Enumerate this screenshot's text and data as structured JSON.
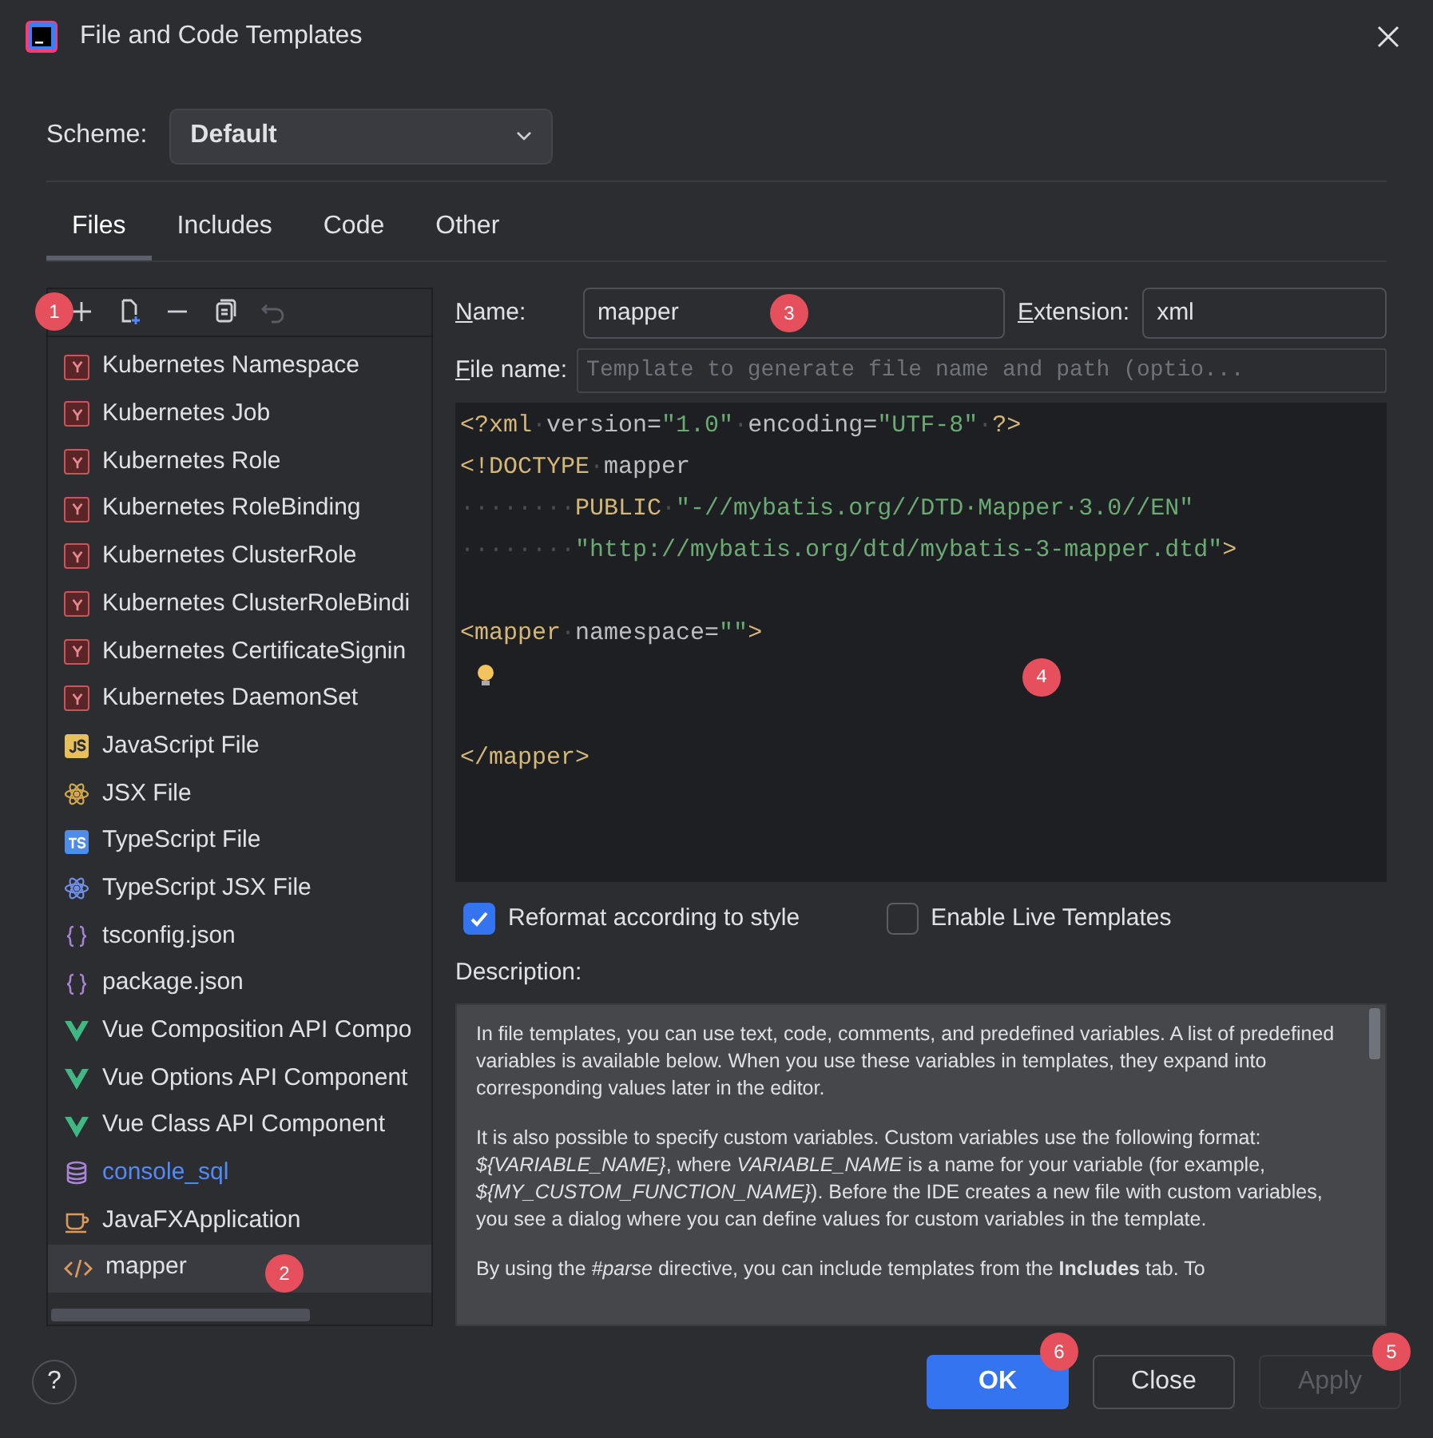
{
  "window": {
    "title": "File and Code Templates"
  },
  "scheme": {
    "label": "Scheme:",
    "value": "Default"
  },
  "tabs": [
    {
      "label": "Files",
      "selected": true
    },
    {
      "label": "Includes",
      "selected": false
    },
    {
      "label": "Code",
      "selected": false
    },
    {
      "label": "Other",
      "selected": false
    }
  ],
  "toolbar": {
    "badge": "1",
    "tools": [
      {
        "kind": "add",
        "disabled": false
      },
      {
        "kind": "new-file",
        "disabled": false
      },
      {
        "kind": "remove",
        "disabled": false
      },
      {
        "kind": "copy",
        "disabled": false
      },
      {
        "kind": "reset",
        "disabled": true
      }
    ]
  },
  "templates": [
    {
      "kind": "kubernetes",
      "label": "Kubernetes Namespace",
      "modified": false,
      "selected": false
    },
    {
      "kind": "kubernetes",
      "label": "Kubernetes Job",
      "modified": false,
      "selected": false
    },
    {
      "kind": "kubernetes",
      "label": "Kubernetes Role",
      "modified": false,
      "selected": false
    },
    {
      "kind": "kubernetes",
      "label": "Kubernetes RoleBinding",
      "modified": false,
      "selected": false
    },
    {
      "kind": "kubernetes",
      "label": "Kubernetes ClusterRole",
      "modified": false,
      "selected": false
    },
    {
      "kind": "kubernetes",
      "label": "Kubernetes ClusterRoleBindi",
      "modified": false,
      "selected": false
    },
    {
      "kind": "kubernetes",
      "label": "Kubernetes CertificateSignin",
      "modified": false,
      "selected": false
    },
    {
      "kind": "kubernetes",
      "label": "Kubernetes DaemonSet",
      "modified": false,
      "selected": false
    },
    {
      "kind": "js",
      "label": "JavaScript File",
      "modified": false,
      "selected": false
    },
    {
      "kind": "react-js",
      "label": "JSX File",
      "modified": false,
      "selected": false
    },
    {
      "kind": "ts",
      "label": "TypeScript File",
      "modified": false,
      "selected": false
    },
    {
      "kind": "react-ts",
      "label": "TypeScript JSX File",
      "modified": false,
      "selected": false
    },
    {
      "kind": "json",
      "label": "tsconfig.json",
      "modified": false,
      "selected": false
    },
    {
      "kind": "json",
      "label": "package.json",
      "modified": false,
      "selected": false
    },
    {
      "kind": "vue",
      "label": "Vue Composition API Compo",
      "modified": false,
      "selected": false
    },
    {
      "kind": "vue",
      "label": "Vue Options API Component",
      "modified": false,
      "selected": false
    },
    {
      "kind": "vue",
      "label": "Vue Class API Component",
      "modified": false,
      "selected": false
    },
    {
      "kind": "database",
      "label": "console_sql",
      "modified": true,
      "selected": false
    },
    {
      "kind": "javafx",
      "label": "JavaFXApplication",
      "modified": false,
      "selected": false
    },
    {
      "kind": "xml",
      "label": "mapper",
      "modified": false,
      "selected": true,
      "badge": "2"
    }
  ],
  "name_field": {
    "label": "Name:",
    "value": "mapper",
    "badge": "3"
  },
  "extension_field": {
    "label": "Extension:",
    "value": "xml"
  },
  "file_name_field": {
    "label": "File name:",
    "placeholder": "Template to generate file name and path (optio..."
  },
  "editor": {
    "badge": "4",
    "lines": [
      {
        "kind": "code",
        "tokens": [
          {
            "kind": "tag",
            "text": "<?xml"
          },
          {
            "kind": "space",
            "text": "·"
          },
          {
            "kind": "attr",
            "text": "version="
          },
          {
            "kind": "string",
            "text": "\"1.0\""
          },
          {
            "kind": "space",
            "text": "·"
          },
          {
            "kind": "attr",
            "text": "encoding="
          },
          {
            "kind": "string",
            "text": "\"UTF-8\""
          },
          {
            "kind": "space",
            "text": "·"
          },
          {
            "kind": "tag",
            "text": "?>"
          }
        ]
      },
      {
        "kind": "code",
        "tokens": [
          {
            "kind": "tag",
            "text": "<!DOCTYPE"
          },
          {
            "kind": "space",
            "text": "·"
          },
          {
            "kind": "attr",
            "text": "mapper"
          }
        ]
      },
      {
        "kind": "code",
        "tokens": [
          {
            "kind": "space",
            "text": "········"
          },
          {
            "kind": "tag",
            "text": "PUBLIC"
          },
          {
            "kind": "space",
            "text": "·"
          },
          {
            "kind": "string",
            "text": "\"-//mybatis.org//DTD·Mapper·3.0//EN\""
          }
        ]
      },
      {
        "kind": "code",
        "tokens": [
          {
            "kind": "space",
            "text": "········"
          },
          {
            "kind": "string",
            "text": "\"http://mybatis.org/dtd/mybatis-3-mapper.dtd\""
          },
          {
            "kind": "tag",
            "text": ">"
          }
        ]
      },
      {
        "kind": "blank"
      },
      {
        "kind": "code",
        "tokens": [
          {
            "kind": "tag",
            "text": "<mapper"
          },
          {
            "kind": "space",
            "text": "·"
          },
          {
            "kind": "attr",
            "text": "namespace="
          },
          {
            "kind": "string",
            "text": "\"\""
          },
          {
            "kind": "tag",
            "text": ">"
          }
        ]
      },
      {
        "kind": "bulb"
      },
      {
        "kind": "blank"
      },
      {
        "kind": "code",
        "tokens": [
          {
            "kind": "tag",
            "text": "</mapper>"
          }
        ]
      }
    ]
  },
  "options": [
    {
      "label": "Reformat according to style",
      "checked": true
    },
    {
      "label": "Enable Live Templates",
      "checked": false
    }
  ],
  "description": {
    "label": "Description:",
    "paragraphs": [
      "In file templates, you can use text, code, comments, and predefined variables. A list of predefined variables is available below. When you use these variables in templates, they expand into corresponding values later in the editor.",
      "It is also possible to specify custom variables. Custom variables use the following format: *${VARIABLE_NAME}*, where *VARIABLE_NAME* is a name for your variable (for example, *${MY_CUSTOM_FUNCTION_NAME}*). Before the IDE creates a new file with custom variables, you see a dialog where you can define values for custom variables in the template.",
      "By using the *#parse* directive, you can include templates from the **Includes** tab. To"
    ]
  },
  "help": {
    "label": "?"
  },
  "buttons": [
    {
      "kind": "primary",
      "label": "OK",
      "disabled": false,
      "badge": "6"
    },
    {
      "kind": "secondary",
      "label": "Close",
      "disabled": false
    },
    {
      "kind": "secondary",
      "label": "Apply",
      "disabled": true,
      "badge": "5"
    }
  ]
}
